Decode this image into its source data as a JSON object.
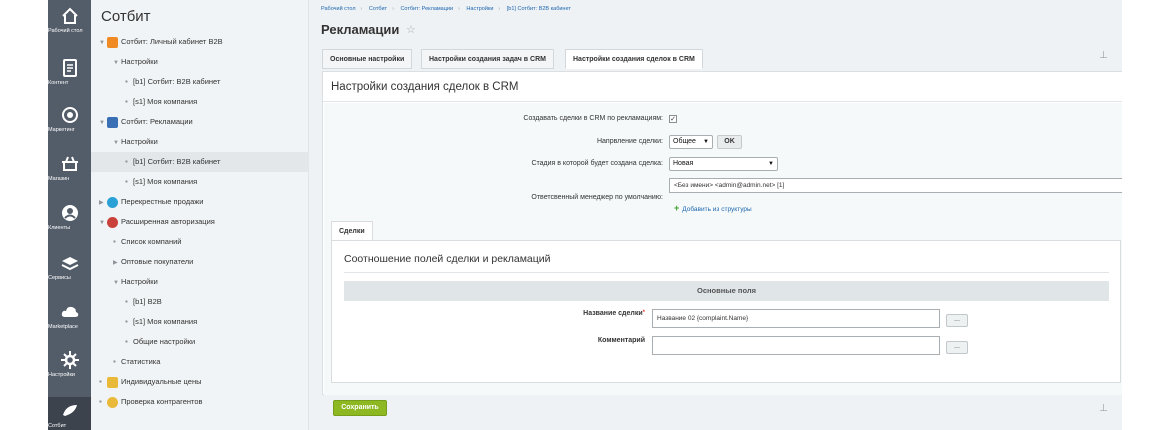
{
  "rail": [
    {
      "label": "Рабочий стол",
      "icon": "home-icon"
    },
    {
      "label": "Контент",
      "icon": "document-icon"
    },
    {
      "label": "Маркетинг",
      "icon": "target-icon"
    },
    {
      "label": "Магазин",
      "icon": "cart-icon"
    },
    {
      "label": "Клиенты",
      "icon": "clients-icon"
    },
    {
      "label": "Сервисы",
      "icon": "layers-icon"
    },
    {
      "label": "Marketplace",
      "icon": "cloud-icon"
    },
    {
      "label": "Настройки",
      "icon": "gear-icon"
    },
    {
      "label": "Сотбит",
      "icon": "sotbit-icon"
    }
  ],
  "tree": {
    "title": "Сотбит",
    "items": [
      {
        "label": "Сотбит: Личный кабинет B2B"
      },
      {
        "label": "Настройки"
      },
      {
        "label": "[b1] Сотбит: B2B кабинет"
      },
      {
        "label": "[s1] Моя компания"
      },
      {
        "label": "Сотбит: Рекламации"
      },
      {
        "label": "Настройки"
      },
      {
        "label": "[b1] Сотбит: B2B кабинет"
      },
      {
        "label": "[s1] Моя компания"
      },
      {
        "label": "Перекрестные продажи"
      },
      {
        "label": "Расширенная авторизация"
      },
      {
        "label": "Список компаний"
      },
      {
        "label": "Оптовые покупатели"
      },
      {
        "label": "Настройки"
      },
      {
        "label": "[b1] B2B"
      },
      {
        "label": "[s1] Моя компания"
      },
      {
        "label": "Общие настройки"
      },
      {
        "label": "Статистика"
      },
      {
        "label": "Индивидуальные цены"
      },
      {
        "label": "Проверка контрагентов"
      }
    ]
  },
  "breadcrumbs": [
    "Рабочий стол",
    "Сотбит",
    "Сотбит: Рекламации",
    "Настройки",
    "[b1] Сотбит: B2B кабинет"
  ],
  "page_title": "Рекламации",
  "tabs": [
    "Основные настройки",
    "Настройки создания задач в CRM",
    "Настройки создания сделок в CRM"
  ],
  "panel": {
    "title": "Настройки создания сделок в CRM",
    "create_deals_label": "Создавать сделки в CRM по рекламациям:",
    "direction_label": "Напрвление сделки:",
    "direction_value": "Общее",
    "ok_label": "OK",
    "stage_label": "Стадия в которой будет создана сделка:",
    "stage_value": "Новая",
    "manager_label": "Ответсвенный менеджер по умолчанию:",
    "manager_value": "<Без имени> <admin@admin.net> [1]",
    "add_from_structure": "Добавить из структуры"
  },
  "subtab": "Сделки",
  "mapping": {
    "title": "Соотношение полей сделки и рекламаций",
    "section": "Основные поля",
    "deal_name_label": "Название сделки",
    "deal_name_required": "*",
    "deal_name_value": "Название 02 {complaint.Name}",
    "comment_label": "Комментарий",
    "comment_value": "",
    "dots": "..."
  },
  "save_label": "Сохранить",
  "colors": {
    "rail": "#535c69",
    "save": "#8db821",
    "link": "#2067b0"
  }
}
